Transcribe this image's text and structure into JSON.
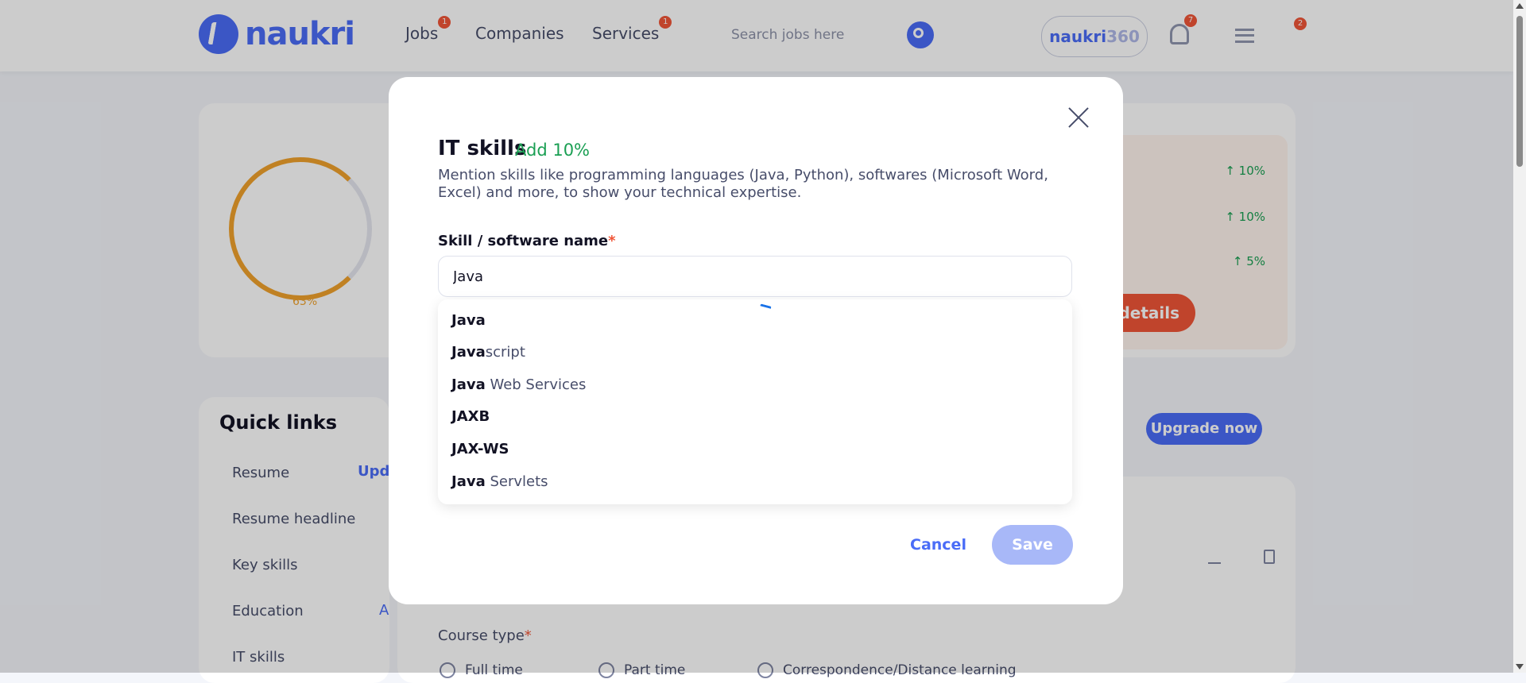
{
  "header": {
    "logo_text": "naukri",
    "nav": [
      {
        "label": "Jobs",
        "badge": "1"
      },
      {
        "label": "Companies"
      },
      {
        "label": "Services",
        "badge": "1"
      }
    ],
    "search_placeholder": "Search jobs here",
    "naukri360": {
      "prefix": "naukri",
      "suffix": "360"
    },
    "bell_badge": "7",
    "menu_badge": "2"
  },
  "profile": {
    "completion": "63%",
    "completion_fraction": 0.63,
    "pending": [
      "↑ 10%",
      "↑ 10%",
      "↑ 5%"
    ],
    "missing_details_label": "details",
    "upgrade_label": "Upgrade now"
  },
  "quick_links": {
    "title": "Quick links",
    "items": [
      "Resume",
      "Resume headline",
      "Key skills",
      "Education",
      "IT skills"
    ],
    "resume_action": "Upd",
    "education_action": "A"
  },
  "background_form": {
    "course_type_label": "Course type",
    "options": [
      "Full time",
      "Part time",
      "Correspondence/Distance learning"
    ]
  },
  "modal": {
    "title": "IT skills",
    "badge": "Add 10%",
    "description": "Mention skills like programming languages (Java, Python), softwares (Microsoft Word, Excel) and more, to show your technical expertise.",
    "field_label": "Skill / software name",
    "required_mark": "*",
    "input_value": "Java",
    "suggestions": [
      {
        "match": "Java",
        "rest": ""
      },
      {
        "match": "Java",
        "rest": "script"
      },
      {
        "match": "Java",
        "rest": " Web Services"
      },
      {
        "match": "JAXB",
        "rest": ""
      },
      {
        "match": "JAX-WS",
        "rest": ""
      },
      {
        "match": "Java",
        "rest": " Servlets"
      }
    ],
    "cancel_label": "Cancel",
    "save_label": "Save"
  }
}
